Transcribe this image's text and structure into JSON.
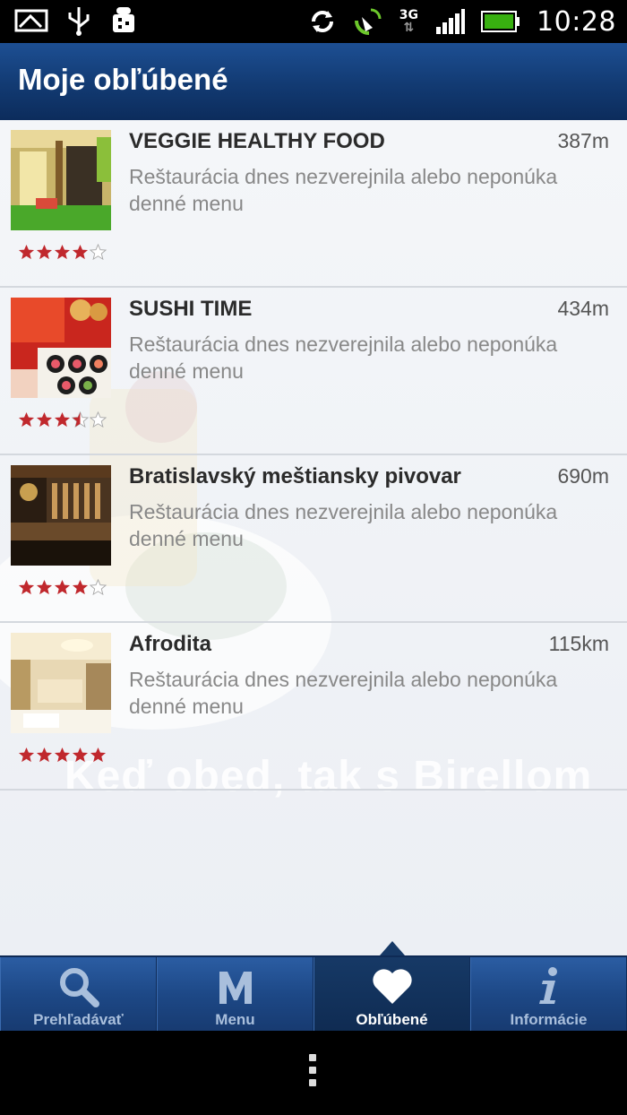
{
  "status_bar": {
    "time": "10:28",
    "network": "3G",
    "icons": [
      "message-icon",
      "usb-icon",
      "debug-android-icon",
      "sync-icon",
      "satellite-icon",
      "signal-icon",
      "battery-icon"
    ]
  },
  "header": {
    "title": "Moje obľúbené"
  },
  "watermark": {
    "text": "Keď obed, tak s Birellom"
  },
  "restaurants": [
    {
      "name": "VEGGIE HEALTHY FOOD",
      "distance": "387m",
      "description": "Reštaurácia dnes nezverejnila alebo neponúka denné menu",
      "rating": 4
    },
    {
      "name": "SUSHI TIME",
      "distance": "434m",
      "description": "Reštaurácia dnes nezverejnila alebo neponúka denné menu",
      "rating": 3.5
    },
    {
      "name": "Bratislavský meštiansky pivovar",
      "distance": "690m",
      "description": "Reštaurácia dnes nezverejnila alebo neponúka denné menu",
      "rating": 4
    },
    {
      "name": "Afrodita",
      "distance": "115km",
      "description": "Reštaurácia dnes nezverejnila alebo neponúka denné menu",
      "rating": 5
    }
  ],
  "tabs": [
    {
      "label": "Prehľadávať",
      "icon": "search-icon",
      "active": false
    },
    {
      "label": "Menu",
      "icon": "menu-m-icon",
      "active": false
    },
    {
      "label": "Obľúbené",
      "icon": "heart-icon",
      "active": true
    },
    {
      "label": "Informácie",
      "icon": "info-icon",
      "active": false
    }
  ],
  "colors": {
    "header": "#123a72",
    "tab_bar": "#1d4886",
    "star": "#c0282d"
  }
}
